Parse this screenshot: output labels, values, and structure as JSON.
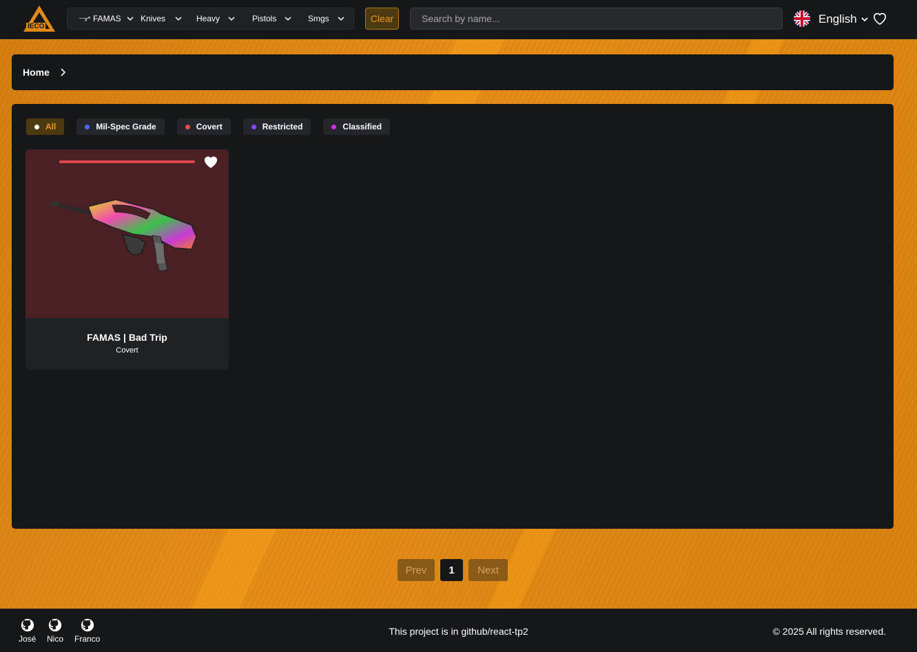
{
  "brand": {
    "logo_text": "IECO"
  },
  "nav": {
    "items": [
      {
        "label": "FAMAS"
      },
      {
        "label": "Knives"
      },
      {
        "label": "Heavy"
      },
      {
        "label": "Pistols"
      },
      {
        "label": "Smgs"
      }
    ],
    "clear_label": "Clear"
  },
  "search": {
    "placeholder": "Search by name...",
    "value": ""
  },
  "language": {
    "label": "English",
    "flag_icon": "uk-flag-icon"
  },
  "breadcrumb": {
    "home": "Home"
  },
  "filters": [
    {
      "label": "All",
      "color": "#ffffff",
      "active": true
    },
    {
      "label": "Mil-Spec Grade",
      "color": "#4b69ff"
    },
    {
      "label": "Covert",
      "color": "#eb4b4b"
    },
    {
      "label": "Restricted",
      "color": "#8847ff"
    },
    {
      "label": "Classified",
      "color": "#d32ce6"
    }
  ],
  "items": [
    {
      "name": "FAMAS | Bad Trip",
      "rarity": "Covert",
      "rarity_color": "#e0474c"
    }
  ],
  "pagination": {
    "prev": "Prev",
    "current": "1",
    "next": "Next"
  },
  "footer": {
    "authors": [
      {
        "name": "José"
      },
      {
        "name": "Nico"
      },
      {
        "name": "Franco"
      }
    ],
    "project_text": "This project is in github/react-tp2",
    "copyright": "© 2025 All rights reserved."
  },
  "colors": {
    "accent": "#e08a18",
    "panel": "#151719"
  }
}
